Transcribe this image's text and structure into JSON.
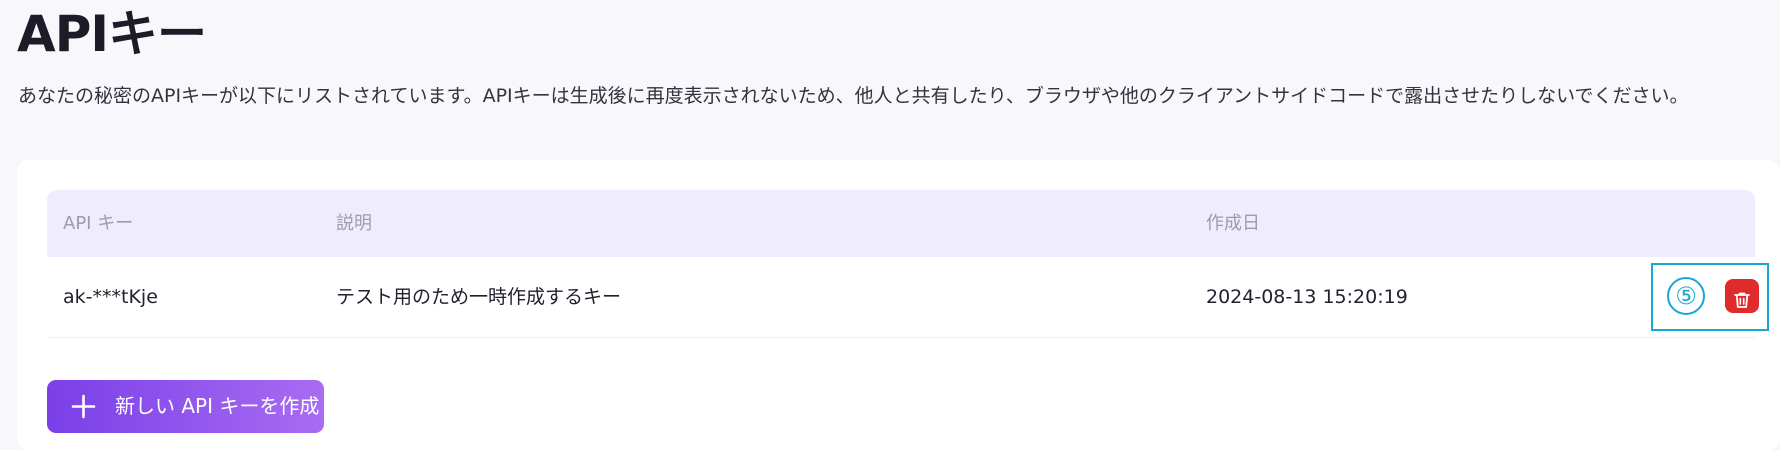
{
  "page": {
    "title": "APIキー",
    "description": "あなたの秘密のAPIキーが以下にリストされています。APIキーは生成後に再度表示されないため、他人と共有したり、ブラウザや他のクライアントサイドコードで露出させたりしないでください。"
  },
  "table": {
    "columns": [
      "API キー",
      "説明",
      "作成日"
    ],
    "rows": [
      {
        "key": "ak-***tKje",
        "description": "テスト用のため一時作成するキー",
        "created": "2024-08-13 15:20:19"
      }
    ]
  },
  "annotation": {
    "step": "⑤",
    "color": "#1aa6d6"
  },
  "icons": {
    "delete": "trash-icon",
    "create": "plus-icon"
  },
  "actions": {
    "create_label": "新しい API キーを作成"
  },
  "colors": {
    "accent_start": "#7a3fe8",
    "accent_end": "#a86cf2",
    "danger": "#e02b2b",
    "header_bg": "#efedfd"
  }
}
